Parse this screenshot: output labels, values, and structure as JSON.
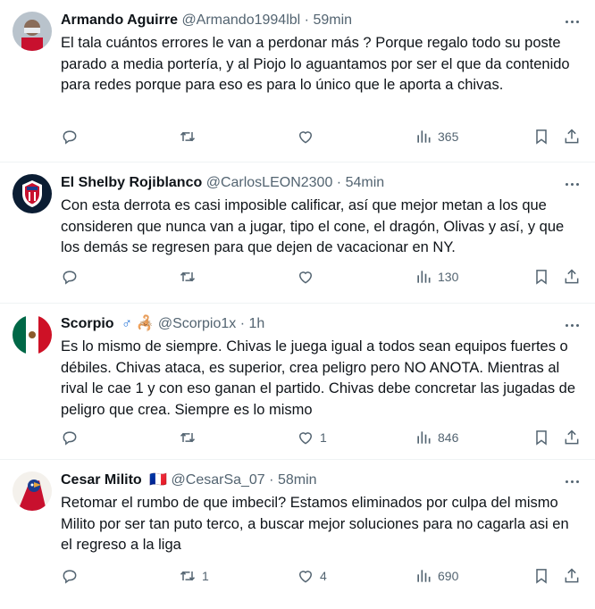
{
  "tweets": [
    {
      "name": "Armando Aguirre",
      "flag": "",
      "handle": "@Armando1994lbl",
      "time": "59min",
      "text": "El tala cuántos errores le van a perdonar más ? Porque regalo todo su poste parado a media portería, y al Piojo lo aguantamos por ser el que da contenido para redes porque para eso es para lo único que le aporta a chivas.",
      "replies": "",
      "retweets": "",
      "likes": "",
      "views": "365"
    },
    {
      "name": "El Shelby Rojiblanco",
      "flag": "",
      "handle": "@CarlosLEON2300",
      "time": "54min",
      "text": "Con esta derrota es casi imposible calificar, así que mejor metan a los que consideren que nunca van a jugar, tipo el cone, el dragón, Olivas y así, y que los demás se regresen para que dejen de vacacionar en NY.",
      "replies": "",
      "retweets": "",
      "likes": "",
      "views": "130"
    },
    {
      "name": "Scorpio",
      "flag": "♂ 🦂",
      "handle": "@Scorpio1x",
      "time": "1h",
      "text": "Es lo mismo de siempre. Chivas le juega igual a todos sean equipos fuertes o débiles. Chivas ataca, es superior, crea peligro pero NO ANOTA. Mientras al rival le cae 1 y con eso ganan el partido. Chivas debe concretar las jugadas de peligro que crea. Siempre es lo mismo",
      "replies": "",
      "retweets": "",
      "likes": "1",
      "views": "846"
    },
    {
      "name": "Cesar Milito",
      "flag": "🇫🇷",
      "handle": "@CesarSa_07",
      "time": "58min",
      "text": "Retomar el rumbo de que imbecil? Estamos eliminados por culpa del mismo Milito por ser tan puto terco, a buscar mejor soluciones para no cagarla asi en el regreso a la liga",
      "replies": "",
      "retweets": "1",
      "likes": "4",
      "views": "690"
    }
  ],
  "separator": "·",
  "colors": {
    "text": "#0f1419",
    "secondary": "#536471",
    "border": "#eff3f4"
  },
  "icons": [
    "reply-icon",
    "retweet-icon",
    "like-icon",
    "views-icon",
    "bookmark-icon",
    "share-icon",
    "more-icon"
  ]
}
